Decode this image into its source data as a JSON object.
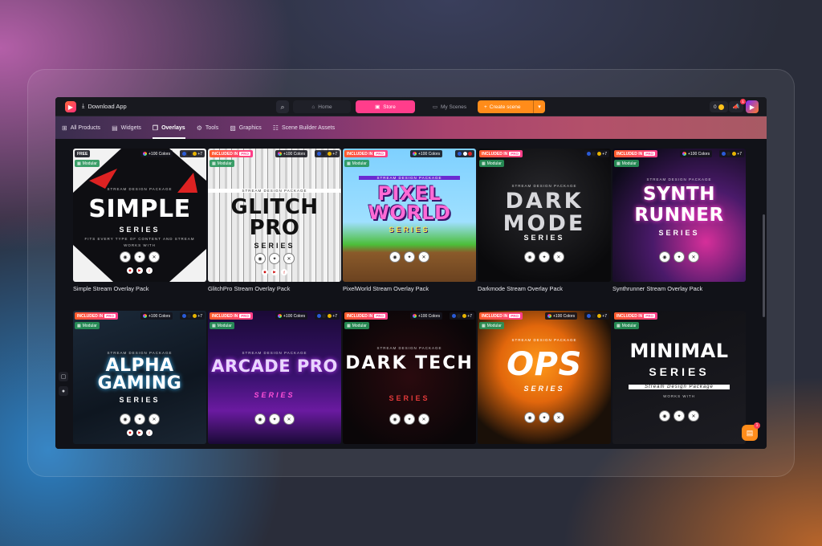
{
  "topbar": {
    "download_label": "Download App",
    "nav": {
      "home": "Home",
      "store": "Store",
      "scenes": "My Scenes",
      "create": "Create scene"
    },
    "coins": "0",
    "notif_count": "1"
  },
  "tabs": [
    {
      "label": "All Products"
    },
    {
      "label": "Widgets"
    },
    {
      "label": "Overlays"
    },
    {
      "label": "Tools"
    },
    {
      "label": "Graphics"
    },
    {
      "label": "Scene Builder Assets"
    }
  ],
  "chat_badge": "1",
  "badges": {
    "free": "FREE",
    "included": "INCLUDED IN",
    "pro": "PRO",
    "colors": "+100 Colors",
    "flags_more": "+7",
    "modular": "Modular"
  },
  "products": [
    {
      "title": "Simple Stream Overlay Pack",
      "art": "SIMPLE",
      "art_sub": "SERIES",
      "badge": "free"
    },
    {
      "title": "GlitchPro Stream Overlay Pack",
      "art": "GLITCH PRO",
      "art_sub": "SERIES",
      "badge": "included"
    },
    {
      "title": "PixelWorld Stream Overlay Pack",
      "art": "PIXEL WORLD",
      "art_sub": "SERIES",
      "badge": "included"
    },
    {
      "title": "Darkmode Stream Overlay Pack",
      "art": "DARK MODE",
      "art_sub": "SERIES",
      "badge": "included"
    },
    {
      "title": "Synthrunner Stream Overlay Pack",
      "art": "SYNTH RUNNER",
      "art_sub": "SERIES",
      "badge": "included"
    },
    {
      "title": "",
      "art": "ALPHA GAMING",
      "art_sub": "SERIES",
      "badge": "included"
    },
    {
      "title": "",
      "art": "ARCADE PRO",
      "art_sub": "SERIES",
      "badge": "included"
    },
    {
      "title": "",
      "art": "DARK TECH",
      "art_sub": "SERIES",
      "badge": "included"
    },
    {
      "title": "",
      "art": "OPS",
      "art_sub": "SERIES",
      "badge": "included"
    },
    {
      "title": "",
      "art": "MINIMAL",
      "art_sub": "SERIES",
      "badge": "included"
    }
  ],
  "art_labels": {
    "package": "STREAM DESIGN PACKAGE",
    "fits": "FITS EVERY TYPE OF CONTENT AND STREAM",
    "works": "WORKS WITH",
    "minimal_script": "Stream Design Package"
  },
  "colors": {
    "store_pink": "#ff3d8b",
    "create_orange": "#ff8c1a",
    "app_bg": "#111218"
  }
}
